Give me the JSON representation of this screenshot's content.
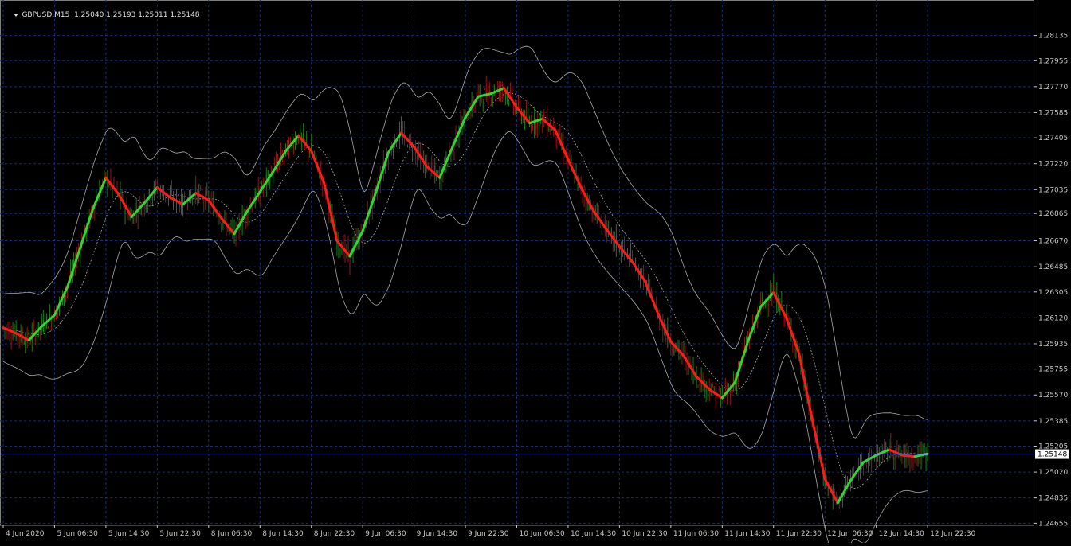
{
  "header": {
    "symbol": "GBPUSD,M15",
    "ohlc": "1.25040 1.25193 1.25011 1.25148"
  },
  "colors": {
    "background": "#000000",
    "grid": "#1c2d6b",
    "candle_up": "#1f7a1f",
    "candle_down": "#8a1a1a",
    "trend_up": "#35d435",
    "trend_down": "#ff1a1a",
    "bands": "#a9a9a9",
    "price_line": "#3f4f9a"
  },
  "chart_data": {
    "type": "line",
    "price_axis": {
      "labels": [
        "1.28135",
        "1.27955",
        "1.27770",
        "1.27585",
        "1.27405",
        "1.27220",
        "1.27035",
        "1.26865",
        "1.26670",
        "1.26485",
        "1.26305",
        "1.26120",
        "1.25935",
        "1.25755",
        "1.25570",
        "1.25385",
        "1.25205",
        "1.25020",
        "1.24835",
        "1.24655"
      ],
      "range": [
        1.2464,
        1.2832
      ]
    },
    "time_axis": {
      "labels": [
        "4 Jun 2020",
        "5 Jun 06:30",
        "5 Jun 14:30",
        "5 Jun 22:30",
        "8 Jun 06:30",
        "8 Jun 14:30",
        "8 Jun 22:30",
        "9 Jun 06:30",
        "9 Jun 14:30",
        "9 Jun 22:30",
        "10 Jun 06:30",
        "10 Jun 14:30",
        "10 Jun 22:30",
        "11 Jun 06:30",
        "11 Jun 14:30",
        "11 Jun 22:30",
        "12 Jun 06:30",
        "12 Jun 14:30",
        "12 Jun 22:30"
      ],
      "bar_index": [
        0,
        32,
        64,
        96,
        128,
        160,
        192,
        224,
        256,
        288,
        320,
        352,
        384,
        416,
        448,
        480,
        512,
        544,
        576
      ],
      "total_bars": 640
    },
    "current_price": "1.25148",
    "series": [
      {
        "x": [
          0,
          8,
          16,
          24,
          32,
          40,
          48,
          56,
          64,
          72,
          80,
          88,
          96,
          104,
          112,
          120,
          128,
          136,
          144,
          152,
          160,
          168,
          176,
          184,
          192,
          200,
          208,
          216,
          224,
          232,
          240,
          248,
          256,
          264,
          272,
          280,
          288,
          296,
          304,
          312,
          320,
          328,
          336,
          344,
          352,
          360,
          368,
          376,
          384,
          392,
          400,
          408,
          416,
          424,
          432,
          440,
          448,
          456,
          464,
          472,
          480,
          488,
          496,
          504,
          512,
          520,
          528,
          536,
          544,
          552,
          560,
          568,
          576
        ],
        "close": [
          1.2605,
          1.2601,
          1.2596,
          1.2606,
          1.2614,
          1.2634,
          1.2662,
          1.269,
          1.2712,
          1.27,
          1.2684,
          1.2694,
          1.2705,
          1.2698,
          1.2693,
          1.2701,
          1.2696,
          1.2683,
          1.2672,
          1.2688,
          1.2702,
          1.2716,
          1.2731,
          1.2742,
          1.2731,
          1.2708,
          1.2667,
          1.2656,
          1.2674,
          1.2701,
          1.273,
          1.2744,
          1.2734,
          1.272,
          1.2712,
          1.2734,
          1.2755,
          1.277,
          1.2772,
          1.2776,
          1.2762,
          1.2751,
          1.2754,
          1.2746,
          1.2725,
          1.2705,
          1.2688,
          1.2675,
          1.2663,
          1.2652,
          1.2638,
          1.2615,
          1.2595,
          1.2585,
          1.257,
          1.2561,
          1.2555,
          1.2566,
          1.2595,
          1.262,
          1.263,
          1.2612,
          1.2586,
          1.254,
          1.2497,
          1.248,
          1.2496,
          1.2509,
          1.2514,
          1.2518,
          1.2514,
          1.2513,
          1.2515
        ]
      }
    ]
  }
}
